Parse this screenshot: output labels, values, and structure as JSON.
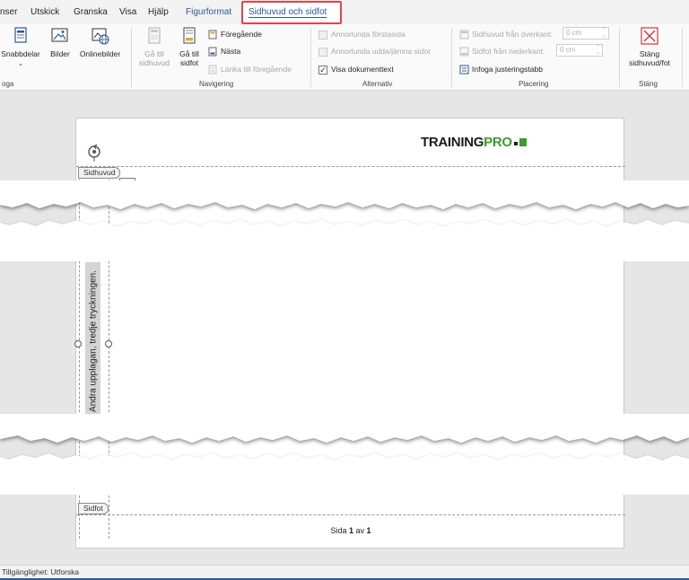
{
  "tabs": [
    {
      "label": "nser",
      "state": "normal"
    },
    {
      "label": "Utskick",
      "state": "normal"
    },
    {
      "label": "Granska",
      "state": "normal"
    },
    {
      "label": "Visa",
      "state": "normal"
    },
    {
      "label": "Hjälp",
      "state": "normal"
    },
    {
      "label": "Figurformat",
      "state": "contextual"
    },
    {
      "label": "Sidhuvud och sidfot",
      "state": "active"
    }
  ],
  "ribbon": {
    "infoga": {
      "label": "oga",
      "snabbdelar": "Snabbdelar",
      "bilder": "Bilder",
      "onlinebilder": "Onlinebilder"
    },
    "navigering": {
      "label": "Navigering",
      "ga_till_sidhuvud_1": "Gå till",
      "ga_till_sidhuvud_2": "sidhuvud",
      "ga_till_sidfot_1": "Gå till",
      "ga_till_sidfot_2": "sidfot",
      "foregaende": "Föregående",
      "nasta": "Nästa",
      "lanka": "Länka till föregående"
    },
    "alternativ": {
      "label": "Alternativ",
      "annorlunda_forstasida": "Annorlunda förstasida",
      "annorlunda_udda": "Annorlunda udda/jämna sidor",
      "visa_dokumenttext": "Visa dokumenttext",
      "visa_dokumenttext_checked": true
    },
    "placering": {
      "label": "Placering",
      "sidhuvud_fran_overkant": "Sidhuvud från överkant:",
      "sidhuvud_value": "0 cm",
      "sidfot_fran_nederkant": "Sidfot från nederkant:",
      "sidfot_value": "0 cm",
      "infoga_justeringstabb": "Infoga justeringstabb"
    },
    "stang": {
      "label": "Stäng",
      "btn_1": "Stäng",
      "btn_2": "sidhuvud/fot"
    }
  },
  "document": {
    "logo_part1": "TRAINING",
    "logo_part2": "PRO",
    "header_tag": "Sidhuvud",
    "footer_tag": "Sidfot",
    "vertical_text": "Andra upplagan, tredje tryckningen.",
    "page_prefix": "Sida ",
    "page_current": "1",
    "page_mid": " av ",
    "page_total": "1"
  },
  "statusbar": {
    "accessibility": "Tillgänglighet: Utforska"
  },
  "colors": {
    "accent": "#2b579a",
    "highlight_border": "#e0454b",
    "logo_green": "#3a9b33"
  }
}
